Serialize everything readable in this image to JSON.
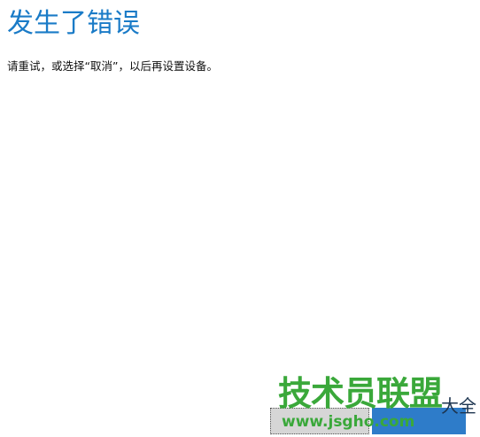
{
  "dialog": {
    "title": "发生了错误",
    "message": "请重试，或选择“取消”，以后再设置设备。"
  },
  "watermark": {
    "brand": "技术员联盟",
    "url": "www.jsgho.com",
    "suffix": "大全"
  },
  "colors": {
    "title": "#1a7bc7",
    "primary_button": "#2e7cc9",
    "secondary_button": "#d6d6d6",
    "watermark": "#3aa83a"
  }
}
